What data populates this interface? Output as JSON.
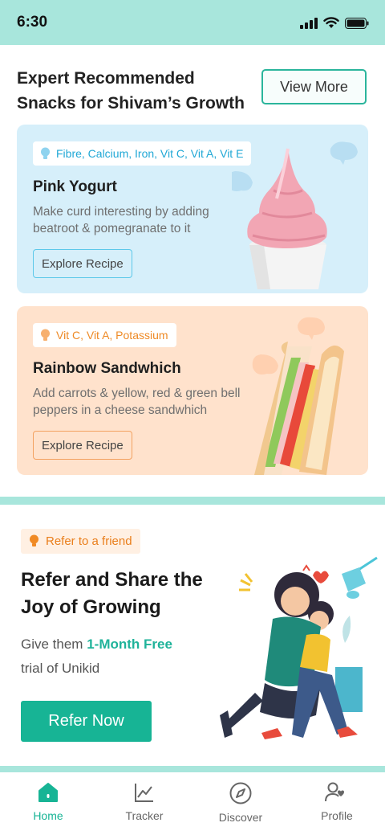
{
  "status": {
    "time": "6:30"
  },
  "snacks": {
    "title_line1": "Expert Recommended",
    "title_line2": "Snacks for Shivam’s Growth",
    "view_more_label": "View More",
    "cards": [
      {
        "nutrients": "Fibre, Calcium, Iron, Vit C, Vit A, Vit E",
        "title": "Pink Yogurt",
        "description": "Make curd interesting by adding beatroot & pomegranate to it",
        "button_label": "Explore Recipe"
      },
      {
        "nutrients": "Vit C, Vit A, Potassium",
        "title": "Rainbow Sandwhich",
        "description": "Add carrots & yellow, red & green bell peppers in a cheese sandwhich",
        "button_label": "Explore Recipe"
      }
    ]
  },
  "refer": {
    "tag": "Refer to a friend",
    "title_line1": "Refer and Share the",
    "title_line2": "Joy of Growing",
    "text_prefix": "Give them",
    "text_highlight": "1-Month Free",
    "text_suffix": "trial of Unikid",
    "button_label": "Refer Now"
  },
  "nav": {
    "items": [
      {
        "label": "Home",
        "icon": "home-icon",
        "active": true
      },
      {
        "label": "Tracker",
        "icon": "chart-icon",
        "active": false
      },
      {
        "label": "Discover",
        "icon": "compass-icon",
        "active": false
      },
      {
        "label": "Profile",
        "icon": "profile-heart-icon",
        "active": false
      }
    ]
  },
  "colors": {
    "accent": "#17b495",
    "status_bar": "#a8e6dc",
    "card_blue": "#d6effa",
    "card_peach": "#ffe2cc",
    "refer_tag": "#ea7f1c"
  }
}
